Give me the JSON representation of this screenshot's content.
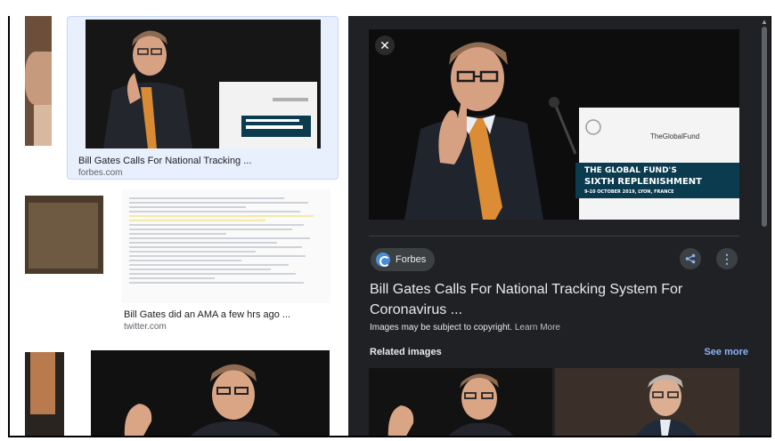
{
  "results": [
    {
      "title": "Bill Gates Calls For National Tracking ...",
      "site": "forbes.com"
    },
    {
      "title": "Bill Gates did an AMA a few hrs ago ...",
      "site": "twitter.com"
    }
  ],
  "panel": {
    "close": "✕",
    "source": "Forbes",
    "headline": "Bill Gates Calls For National Tracking System For Coronavirus ...",
    "copyright": "Images may be subject to copyright.",
    "learn_more": "Learn More",
    "related_label": "Related images",
    "see_more": "See more",
    "share_icon": "share-icon",
    "more_icon": "more-vert-icon"
  },
  "image_text": {
    "sign_brand": "TheGlobalFund",
    "sign_line1": "THE GLOBAL FUND'S",
    "sign_line2": "SIXTH REPLENISHMENT",
    "sign_line3": "9-10 OCTOBER 2019, LYON, FRANCE"
  },
  "colors": {
    "panel_bg": "#202124",
    "link": "#8ab4f8",
    "selected_card": "#e8f0fe"
  }
}
